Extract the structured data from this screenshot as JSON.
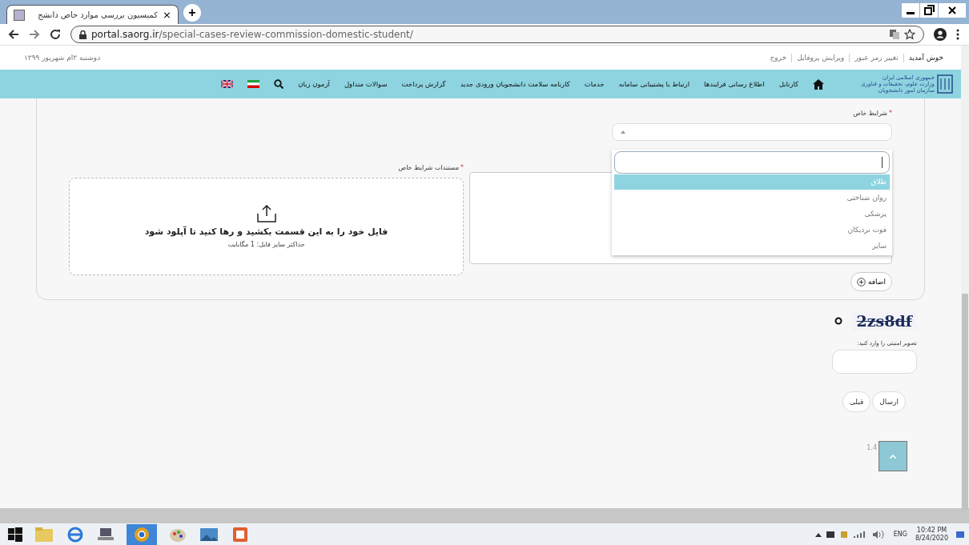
{
  "browser": {
    "tab_title": "کمیسیون بررسی موارد خاص دانشج",
    "tab_close": "×",
    "new_tab": "+",
    "url_host": "portal.saorg.ir",
    "url_path": "/special-cases-review-commission-domestic-student/"
  },
  "top_bar": {
    "date": "دوشنبه ۳ام شهریور ۱۳۹۹",
    "links": [
      "خوش آمدید",
      "تغییر رمز عبور",
      "ویرایش پروفایل",
      "خروج"
    ]
  },
  "logo": {
    "lines": [
      "جمهوری اسلامی ایران",
      "وزارت علوم، تحقیقات و فناوری",
      "سازمان امور دانشجویان"
    ]
  },
  "nav": {
    "items": [
      "کارتابل",
      "اطلاع رسانی فرایندها",
      "ارتباط با پشتیبانی سامانه",
      "خدمات",
      "کارنامه سلامت دانشجویان ورودی جدید",
      "گزارش پرداخت",
      "سوالات متداول",
      "آزمون زبان"
    ]
  },
  "form": {
    "conditions_label": "شرایط خاص",
    "conditions_required_mark": "*",
    "options": [
      {
        "label": "طلاق",
        "selected": true
      },
      {
        "label": "روان شناختی",
        "selected": false
      },
      {
        "label": "پزشکی",
        "selected": false
      },
      {
        "label": "فوت نزدیکان",
        "selected": false
      },
      {
        "label": "سایر",
        "selected": false
      }
    ],
    "documents_label": "مستندات شرایط خاص",
    "documents_required_mark": "*",
    "dropzone_text": "فایل خود را به این قسمت بکشید و رها کنید تا آپلود شود",
    "dropzone_hint": "حداکثر سایز فایل: 1 مگابایت",
    "add_button": "اضافه"
  },
  "captcha": {
    "code": "2zs8df",
    "label": "تصویر امنیتی را وارد کنید:"
  },
  "buttons": {
    "submit": "ارسال",
    "back": "قبلی"
  },
  "version": "1.4",
  "taskbar": {
    "language": "ENG",
    "time": "10:42 PM",
    "date": "8/24/2020"
  }
}
